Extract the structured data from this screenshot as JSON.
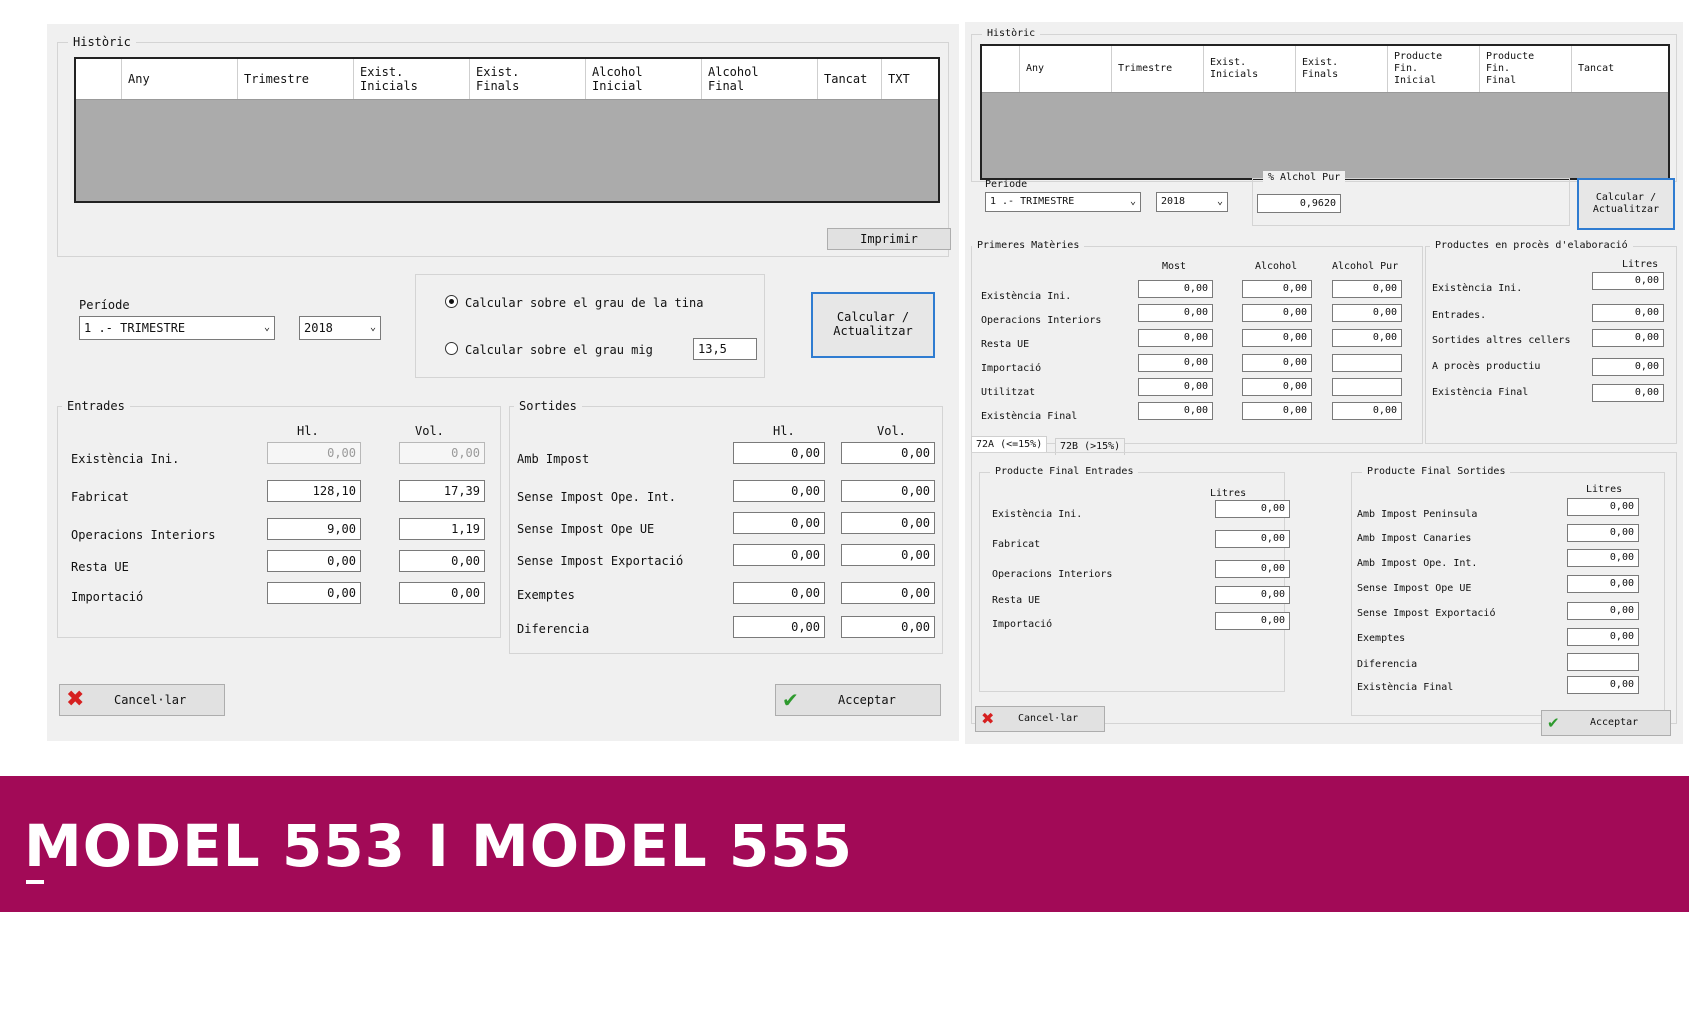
{
  "banner": {
    "title": "MODEL 553 I MODEL 555",
    "color": "#a20a57"
  },
  "m553": {
    "historic_label": "Històric",
    "grid_columns": [
      "",
      "Any",
      "Trimestre",
      "Exist.\nInicials",
      "Exist.\nFinals",
      "Alcohol\nInicial",
      "Alcohol\nFinal",
      "Tancat",
      "TXT"
    ],
    "imprimir": "Imprimir",
    "periode_label": "Període",
    "periode_value": "1 .- TRIMESTRE",
    "year_value": "2018",
    "radio1": "Calcular sobre el grau de la tina",
    "radio2": "Calcular sobre el grau mig",
    "grau_mig": "13,5",
    "calcular": "Calcular /\nActualitzar",
    "entrades": {
      "label": "Entrades",
      "col_hl": "Hl.",
      "col_vol": "Vol.",
      "rows": [
        {
          "label": "Existència Ini.",
          "hl": "0,00",
          "vol": "0,00"
        },
        {
          "label": "Fabricat",
          "hl": "128,10",
          "vol": "17,39"
        },
        {
          "label": "Operacions Interiors",
          "hl": "9,00",
          "vol": "1,19"
        },
        {
          "label": "Resta UE",
          "hl": "0,00",
          "vol": "0,00"
        },
        {
          "label": "Importació",
          "hl": "0,00",
          "vol": "0,00"
        }
      ]
    },
    "sortides": {
      "label": "Sortides",
      "col_hl": "Hl.",
      "col_vol": "Vol.",
      "rows": [
        {
          "label": "Amb Impost",
          "hl": "0,00",
          "vol": "0,00"
        },
        {
          "label": "Sense Impost Ope. Int.",
          "hl": "0,00",
          "vol": "0,00"
        },
        {
          "label": "Sense Impost Ope UE",
          "hl": "0,00",
          "vol": "0,00"
        },
        {
          "label": "Sense Impost Exportació",
          "hl": "0,00",
          "vol": "0,00"
        },
        {
          "label": "Exemptes",
          "hl": "0,00",
          "vol": "0,00"
        },
        {
          "label": "Diferencia",
          "hl": "0,00",
          "vol": "0,00"
        }
      ]
    },
    "cancel": "Cancel·lar",
    "accept": "Acceptar"
  },
  "m555": {
    "historic_label": "Històric",
    "grid_columns": [
      "",
      "Any",
      "Trimestre",
      "Exist.\nInicials",
      "Exist.\nFinals",
      "Producte\nFin.\nInicial",
      "Producte\nFin.\nFinal",
      "Tancat"
    ],
    "periode_label": "Periode",
    "periode_value": "1 .- TRIMESTRE",
    "year_value": "2018",
    "alchol_label": "% Alchol Pur",
    "alchol_value": "0,9620",
    "calcular": "Calcular /\nActualitzar",
    "primeres": {
      "label": "Primeres Matèries",
      "cols": [
        "Most",
        "Alcohol",
        "Alcohol Pur"
      ],
      "rows": [
        {
          "label": "Existència Ini.",
          "v": [
            "0,00",
            "0,00",
            "0,00"
          ]
        },
        {
          "label": "Operacions Interiors",
          "v": [
            "0,00",
            "0,00",
            "0,00"
          ]
        },
        {
          "label": "Resta UE",
          "v": [
            "0,00",
            "0,00",
            "0,00"
          ]
        },
        {
          "label": "Importació",
          "v": [
            "0,00",
            "0,00",
            ""
          ]
        },
        {
          "label": "Utilitzat",
          "v": [
            "0,00",
            "0,00",
            ""
          ]
        },
        {
          "label": "Existència Final",
          "v": [
            "0,00",
            "0,00",
            "0,00"
          ]
        }
      ]
    },
    "proces": {
      "label": "Productes en procès d'elaboració",
      "col": "Litres",
      "rows": [
        {
          "label": "Existència Ini.",
          "v": "0,00"
        },
        {
          "label": "Entrades.",
          "v": "0,00"
        },
        {
          "label": "Sortides altres cellers",
          "v": "0,00"
        },
        {
          "label": "A procès productiu",
          "v": "0,00"
        },
        {
          "label": "Existència Final",
          "v": "0,00"
        }
      ]
    },
    "tabs": [
      "72A (<=15%)",
      "72B (>15%)"
    ],
    "pf_entrades": {
      "label": "Producte Final Entrades",
      "col": "Litres",
      "rows": [
        {
          "label": "Existència Ini.",
          "v": "0,00"
        },
        {
          "label": "Fabricat",
          "v": "0,00"
        },
        {
          "label": "Operacions Interiors",
          "v": "0,00"
        },
        {
          "label": "Resta UE",
          "v": "0,00"
        },
        {
          "label": "Importació",
          "v": "0,00"
        }
      ]
    },
    "pf_sortides": {
      "label": "Producte Final Sortides",
      "col": "Litres",
      "rows": [
        {
          "label": "Amb Impost Peninsula",
          "v": "0,00"
        },
        {
          "label": "Amb Impost Canaries",
          "v": "0,00"
        },
        {
          "label": "Amb Impost Ope. Int.",
          "v": "0,00"
        },
        {
          "label": "Sense Impost Ope UE",
          "v": "0,00"
        },
        {
          "label": "Sense Impost Exportació",
          "v": "0,00"
        },
        {
          "label": "Exemptes",
          "v": "0,00"
        },
        {
          "label": "Diferencia",
          "v": ""
        },
        {
          "label": "Existència Final",
          "v": "0,00"
        }
      ]
    },
    "cancel": "Cancel·lar",
    "accept": "Acceptar"
  }
}
